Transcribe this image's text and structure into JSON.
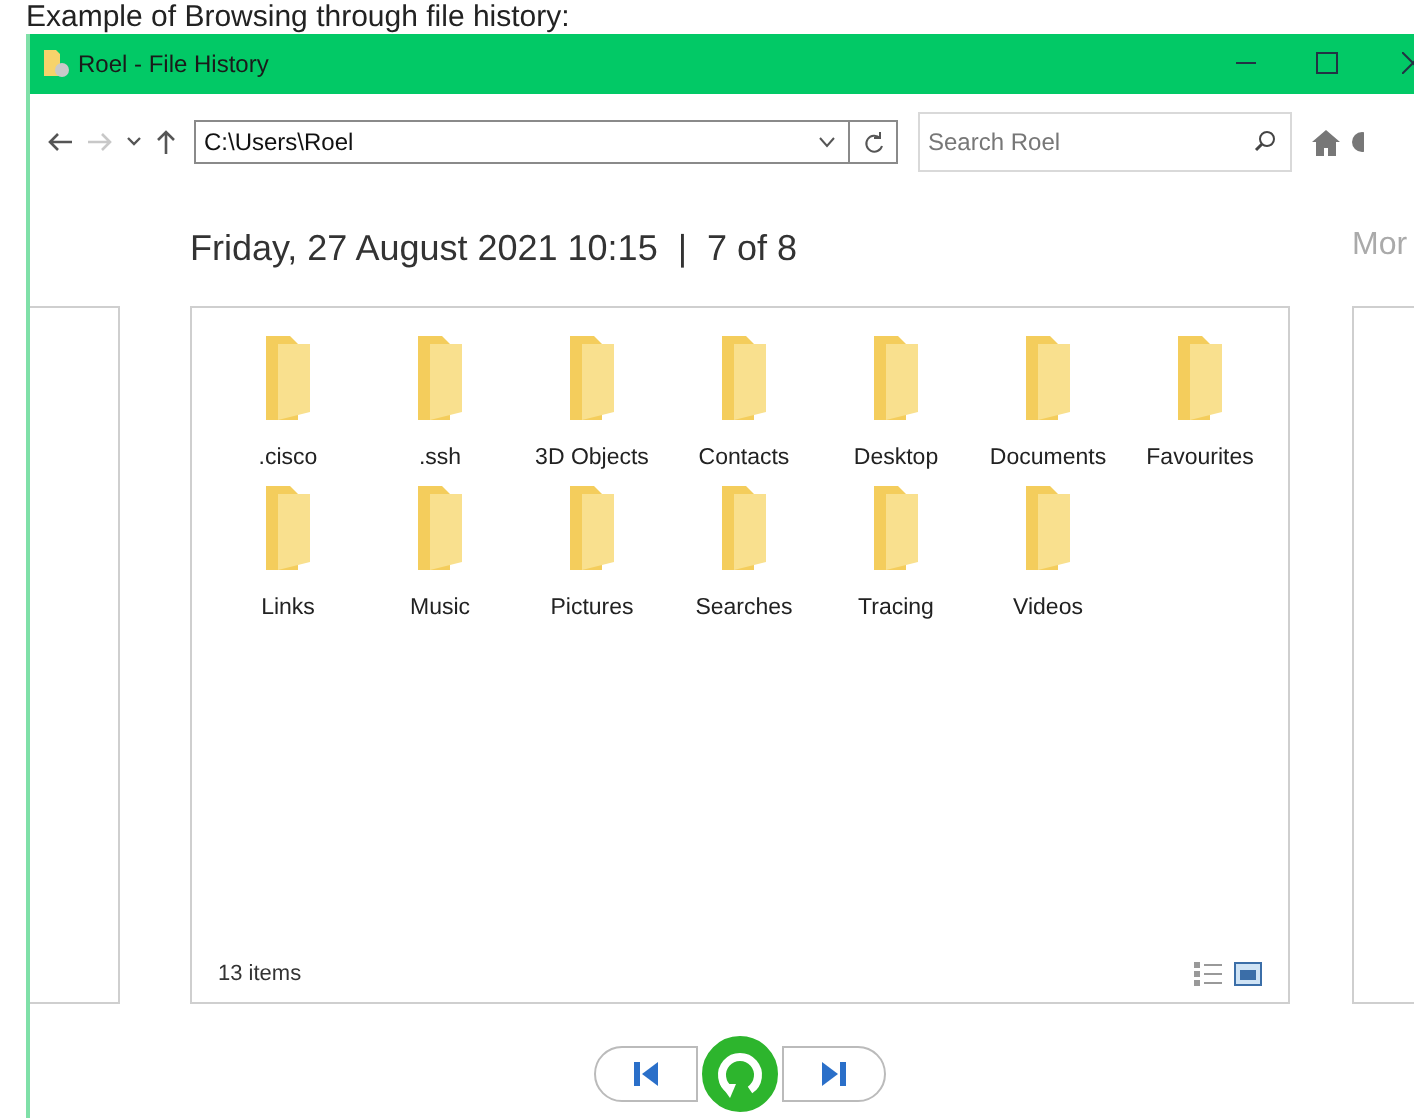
{
  "caption": "Example of Browsing through file history:",
  "window": {
    "title": "Roel - File History"
  },
  "toolbar": {
    "nav": [
      {
        "kind": "back",
        "disabled": false
      },
      {
        "kind": "forward",
        "disabled": true
      },
      {
        "kind": "recent",
        "disabled": false
      },
      {
        "kind": "up",
        "disabled": false
      }
    ],
    "address": "C:\\Users\\Roel",
    "search": {
      "placeholder": "Search Roel"
    }
  },
  "snapshot": {
    "date": "Friday, 27 August 2021 10:15",
    "separator": "|",
    "position": "7 of 8"
  },
  "next_snapshot_heading": "Mor",
  "folders": [
    {
      "name": ".cisco"
    },
    {
      "name": ".ssh"
    },
    {
      "name": "3D Objects"
    },
    {
      "name": "Contacts"
    },
    {
      "name": "Desktop"
    },
    {
      "name": "Documents"
    },
    {
      "name": "Favourites"
    },
    {
      "name": "Links"
    },
    {
      "name": "Music"
    },
    {
      "name": "Pictures"
    },
    {
      "name": "Searches"
    },
    {
      "name": "Tracing"
    },
    {
      "name": "Videos"
    }
  ],
  "status": {
    "item_count": "13 items"
  }
}
